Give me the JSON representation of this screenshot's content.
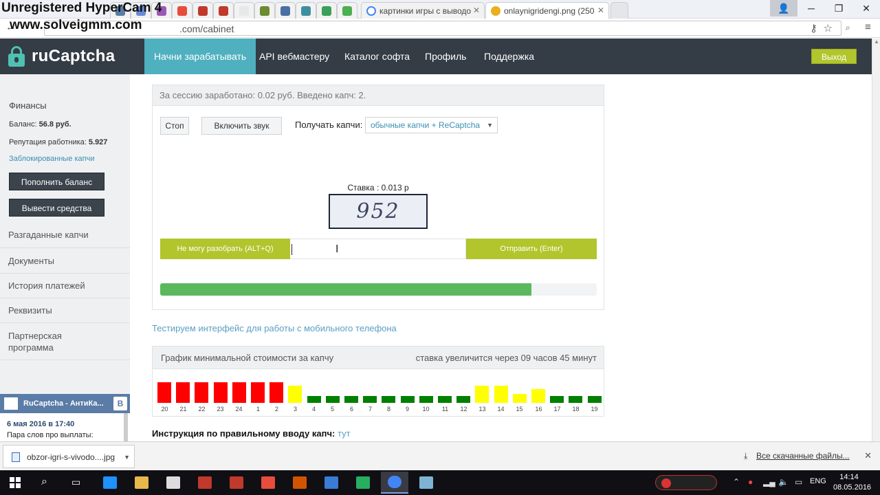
{
  "watermark": {
    "line1": "Unregistered HyperCam 4",
    "line2": "www.solveigmm.com"
  },
  "browser": {
    "tabs": [
      {
        "label": "картинки игры с выводо",
        "icon": "google-icon",
        "color": "#4285f4"
      },
      {
        "label": "onlaynigridengi.png (250",
        "icon": "image-icon",
        "color": "#e8b020"
      }
    ],
    "pinned_tab_colors": [
      "#5a7ca6",
      "#6b8ad6",
      "#9b59b6",
      "#e74c3c",
      "#c0392b",
      "#c0392b",
      "#e8e8e8",
      "#6c8a2f",
      "#4a6fa5",
      "#3d8fa0",
      "#3aa05a",
      "#4caf50"
    ],
    "url": {
      "host": "",
      "path": ".com/cabinet"
    }
  },
  "site": {
    "logo": "ruCaptcha",
    "nav": [
      {
        "label": "Начни зарабатывать",
        "active": true
      },
      {
        "label": "API вебмастеру",
        "active": false
      },
      {
        "label": "Каталог софта",
        "active": false
      },
      {
        "label": "Профиль",
        "active": false
      },
      {
        "label": "Поддержка",
        "active": false
      }
    ],
    "logout": "Выход"
  },
  "sidebar": {
    "finances": "Финансы",
    "balance_label": "Баланс:",
    "balance_value": "56.8 руб.",
    "reputation_label": "Репутация работника:",
    "reputation_value": "5.927",
    "blocked": "Заблокированные капчи",
    "topup": "Пополнить баланс",
    "withdraw": "Вывести средства",
    "menu": [
      "Разгаданные капчи",
      "Документы",
      "История платежей",
      "Реквизиты",
      "Партнерская программа"
    ]
  },
  "vk_widget": {
    "title": "RuCaptcha - АнтиКа...",
    "badge": "B",
    "date": "6 мая 2016 в 17:40",
    "text": "Пара слов про выплаты:"
  },
  "work": {
    "session": "За сессию заработано: 0.02 руб. Введено капч: 2.",
    "stop": "Стоп",
    "sound": "Включить звук",
    "get_label": "Получать капчи:",
    "get_value": "обычные капчи + ReCaptcha",
    "rate": "Ставка : 0.013 р",
    "captcha_text": "952",
    "cant_solve": "Не могу разобрать  (ALT+Q)",
    "input_value": "",
    "send": "Отправить (Enter)",
    "progress": 0.85
  },
  "mobile_link": "Тестируем интерфейс для работы с мобильного телефона",
  "graph": {
    "title": "График минимальной стоимости за капчу",
    "note": "ставка увеличится через 09 часов 45 минут",
    "colors": {
      "high": "#ff0000",
      "mid": "#ffff00",
      "low": "#008000"
    }
  },
  "chart_data": {
    "type": "bar",
    "categories": [
      "20",
      "21",
      "22",
      "23",
      "24",
      "1",
      "2",
      "3",
      "4",
      "5",
      "6",
      "7",
      "8",
      "9",
      "10",
      "11",
      "12",
      "13",
      "14",
      "15",
      "16",
      "17",
      "18",
      "19"
    ],
    "values": [
      3,
      3,
      3,
      3,
      3,
      3,
      3,
      2.5,
      1,
      1,
      1,
      1,
      1,
      1,
      1,
      1,
      1,
      2.5,
      2.5,
      1.3,
      2,
      1,
      1,
      1
    ],
    "levels": [
      "high",
      "high",
      "high",
      "high",
      "high",
      "high",
      "high",
      "mid",
      "low",
      "low",
      "low",
      "low",
      "low",
      "low",
      "low",
      "low",
      "low",
      "mid",
      "mid",
      "mid",
      "mid",
      "low",
      "low",
      "low"
    ],
    "title": "",
    "xlabel": "",
    "ylabel": "",
    "ylim": [
      0,
      3
    ]
  },
  "instructions": {
    "label": "Инструкция по правильному вводу капч:",
    "link": "тут"
  },
  "downloads": {
    "file": "obzor-igri-s-vivodo....jpg",
    "all": "Все скачанные файлы..."
  },
  "taskbar": {
    "lang": "ENG",
    "time": "14:14",
    "date": "08.05.2016",
    "apps": [
      "#1e90ff",
      "#e8b84a",
      "#ddd",
      "#c0392b",
      "#c0392b",
      "#e74c3c",
      "#d35400",
      "#3a7bd5",
      "#27ae60",
      "#4285f4",
      "#7fb3d5"
    ]
  }
}
